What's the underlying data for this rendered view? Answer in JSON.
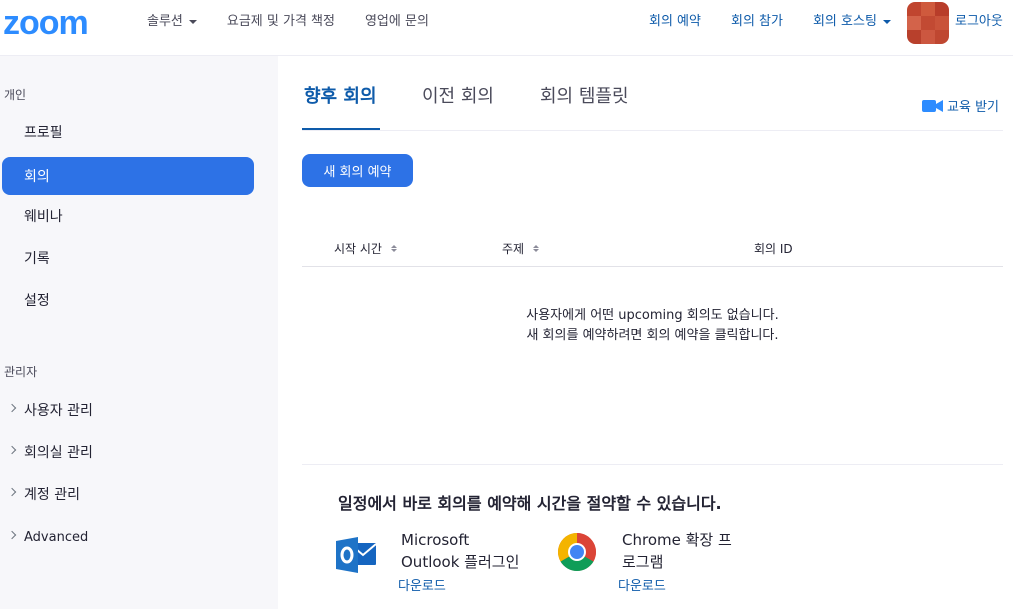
{
  "header": {
    "logo": "zoom",
    "nav_left": [
      {
        "label": "솔루션",
        "dropdown": true
      },
      {
        "label": "요금제 및 가격 책정",
        "dropdown": false
      },
      {
        "label": "영업에 문의",
        "dropdown": false
      }
    ],
    "nav_right": [
      {
        "label": "회의 예약",
        "dropdown": false
      },
      {
        "label": "회의 참가",
        "dropdown": false
      },
      {
        "label": "회의 호스팅",
        "dropdown": true
      }
    ],
    "logout": "로그아웃"
  },
  "sidebar": {
    "personal_label": "개인",
    "personal_items": [
      {
        "label": "프로필",
        "active": false
      },
      {
        "label": "회의",
        "active": true
      },
      {
        "label": "웨비나",
        "active": false
      },
      {
        "label": "기록",
        "active": false
      },
      {
        "label": "설정",
        "active": false
      }
    ],
    "admin_label": "관리자",
    "admin_items": [
      {
        "label": "사용자 관리"
      },
      {
        "label": "회의실 관리"
      },
      {
        "label": "계정 관리"
      },
      {
        "label": "Advanced"
      }
    ]
  },
  "main": {
    "tabs": [
      {
        "label": "향후 회의",
        "active": true
      },
      {
        "label": "이전 회의",
        "active": false
      },
      {
        "label": "회의 템플릿",
        "active": false
      }
    ],
    "training": "교육 받기",
    "schedule_button": "새 회의 예약",
    "table_headers": [
      "시작 시간",
      "주제",
      "회의 ID"
    ],
    "empty_line1": "사용자에게 어떤 upcoming 회의도 없습니다.",
    "empty_line2": "새 회의를 예약하려면 회의 예약을 클릭합니다.",
    "promo_title": "일정에서 바로 회의를 예약해 시간을 절약할 수 있습니다.",
    "plugins": [
      {
        "name_line1": "Microsoft",
        "name_line2": "Outlook 플러그인",
        "download": "다운로드",
        "icon": "outlook-icon"
      },
      {
        "name_line1": "Chrome 확장 프",
        "name_line2": "로그램",
        "download": "다운로드",
        "icon": "chrome-icon"
      }
    ]
  },
  "colors": {
    "brand": "#2d8cff",
    "primary_button": "#2d72e6",
    "link": "#0e5baa",
    "sidebar_bg": "#f7f7fa"
  }
}
